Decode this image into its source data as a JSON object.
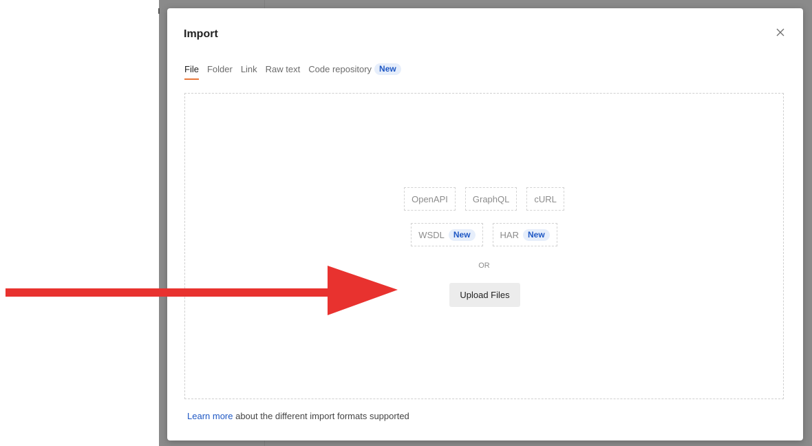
{
  "modal": {
    "title": "Import",
    "tabs": [
      {
        "label": "File",
        "active": true
      },
      {
        "label": "Folder",
        "active": false
      },
      {
        "label": "Link",
        "active": false
      },
      {
        "label": "Raw text",
        "active": false
      },
      {
        "label": "Code repository",
        "active": false,
        "badge": "New"
      }
    ],
    "formats_row1": [
      {
        "label": "OpenAPI"
      },
      {
        "label": "GraphQL"
      },
      {
        "label": "cURL"
      }
    ],
    "formats_row2": [
      {
        "label": "WSDL",
        "badge": "New"
      },
      {
        "label": "HAR",
        "badge": "New"
      }
    ],
    "or_text": "OR",
    "upload_label": "Upload Files",
    "footer": {
      "link_text": "Learn more",
      "rest_text": " about the different import formats supported"
    }
  },
  "icons": {
    "close": "close-icon",
    "arrow": "red-arrow-annotation"
  },
  "colors": {
    "accent": "#e8773a",
    "badge_bg": "#e6eefb",
    "badge_text": "#1f58c4",
    "overlay": "#8a8a8a",
    "arrow": "#e8322f"
  }
}
